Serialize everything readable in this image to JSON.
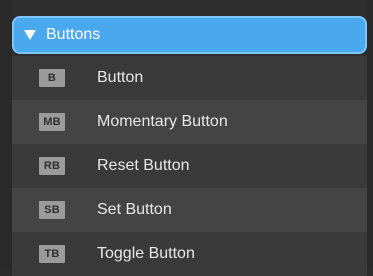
{
  "group": {
    "label": "Buttons"
  },
  "items": [
    {
      "badge": "B",
      "label": "Button"
    },
    {
      "badge": "MB",
      "label": "Momentary Button"
    },
    {
      "badge": "RB",
      "label": "Reset Button"
    },
    {
      "badge": "SB",
      "label": "Set Button"
    },
    {
      "badge": "TB",
      "label": "Toggle Button"
    }
  ],
  "colors": {
    "header_bg": "#4aa8ef",
    "header_border": "#7ec6ff",
    "badge_bg": "#9b9b9b"
  }
}
